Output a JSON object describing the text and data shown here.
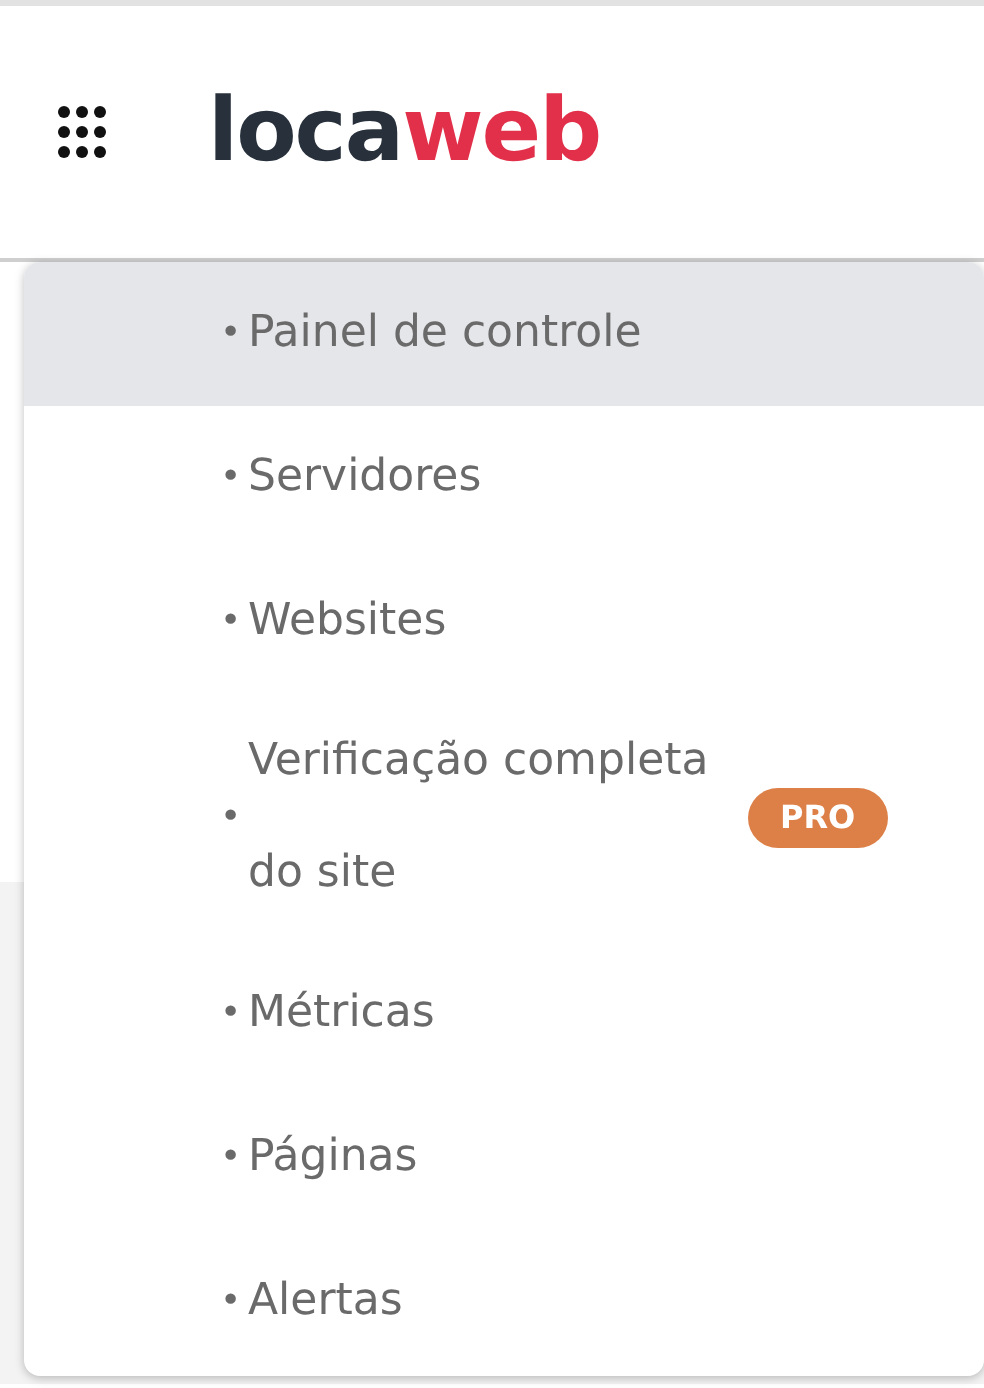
{
  "header": {
    "logo": {
      "dark_part": "loca",
      "accent_part": "web"
    }
  },
  "menu": {
    "items": [
      {
        "bullet": "•",
        "label": "Painel de controle",
        "selected": true
      },
      {
        "bullet": "•",
        "label": "Servidores",
        "selected": false
      },
      {
        "bullet": "•",
        "label": "Websites",
        "selected": false
      },
      {
        "bullet": "•",
        "label": "Verificação completa do site",
        "selected": false,
        "badge": "PRO"
      },
      {
        "bullet": "•",
        "label": "Métricas",
        "selected": false
      },
      {
        "bullet": "•",
        "label": "Páginas",
        "selected": false
      },
      {
        "bullet": "•",
        "label": "Alertas",
        "selected": false
      }
    ]
  }
}
